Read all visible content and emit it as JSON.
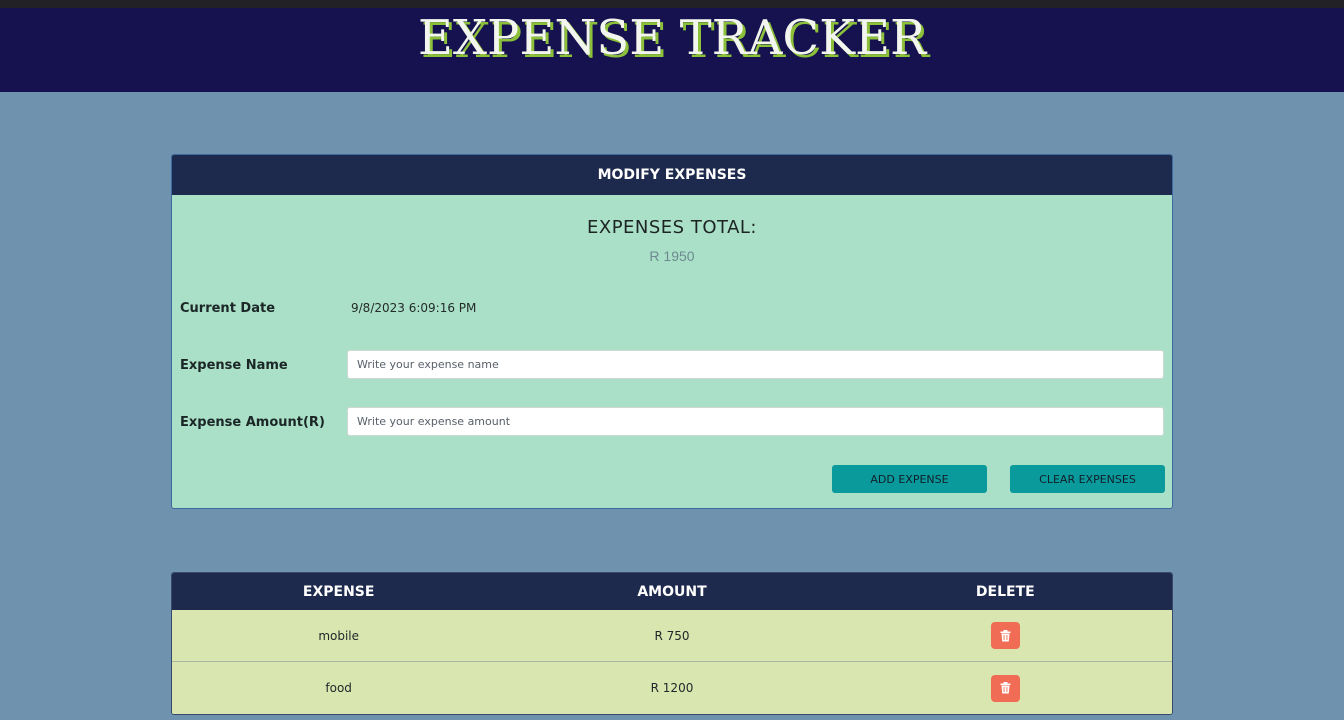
{
  "app": {
    "title": "EXPENSE TRACKER"
  },
  "modify": {
    "header": "MODIFY EXPENSES",
    "total_label": "EXPENSES TOTAL:",
    "total_value": "R 1950",
    "date_label": "Current Date",
    "date_value": "9/8/2023 6:09:16 PM",
    "name_label": "Expense Name",
    "name_placeholder": "Write your expense name",
    "name_value": "",
    "amount_label": "Expense Amount(R)",
    "amount_placeholder": "Write your expense amount",
    "amount_value": "",
    "add_button": "ADD EXPENSE",
    "clear_button": "CLEAR EXPENSES"
  },
  "table": {
    "headers": [
      "EXPENSE",
      "AMOUNT",
      "DELETE"
    ],
    "rows": [
      {
        "expense": "mobile",
        "amount": "R 750",
        "delete_icon": "trash-icon"
      },
      {
        "expense": "food",
        "amount": "R 1200",
        "delete_icon": "trash-icon"
      }
    ]
  },
  "colors": {
    "page_background": "#6f92ae",
    "header_background": "#161250",
    "title_shadow": "#8cbf3a",
    "panel_header": "#1d2a4d",
    "form_background": "#abe0c8",
    "button": "#0a9a9c",
    "table_row": "#dae6b0",
    "delete_button": "#f06c55"
  }
}
